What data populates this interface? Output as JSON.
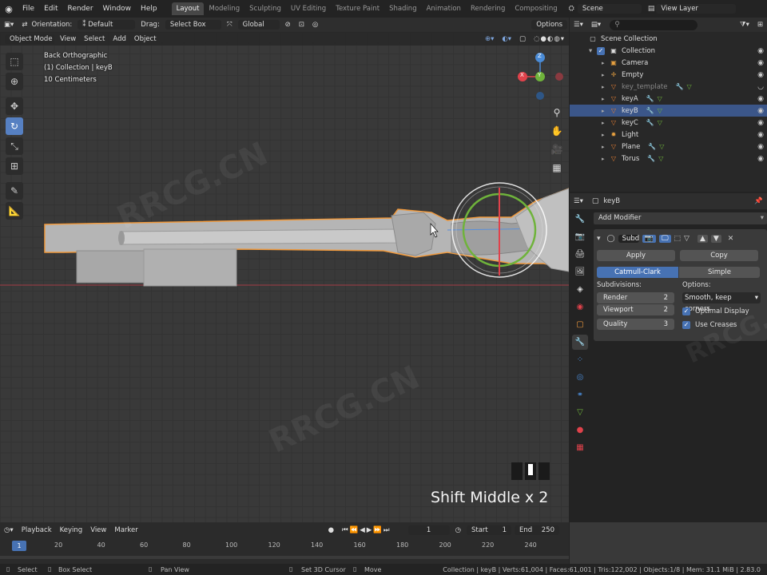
{
  "topbar": {
    "menus": [
      "File",
      "Edit",
      "Render",
      "Window",
      "Help"
    ],
    "workspaces": [
      "Layout",
      "Modeling",
      "Sculpting",
      "UV Editing",
      "Texture Paint",
      "Shading",
      "Animation",
      "Rendering",
      "Compositing"
    ],
    "active_workspace": "Layout",
    "scene": "Scene",
    "view_layer": "View Layer"
  },
  "viewport_header": {
    "orientation_label": "Orientation:",
    "orientation_value": "Default",
    "drag_label": "Drag:",
    "drag_value": "Select Box",
    "transform_value": "Global",
    "options_label": "Options"
  },
  "viewport_menu": {
    "mode": "Object Mode",
    "items": [
      "View",
      "Select",
      "Add",
      "Object"
    ]
  },
  "overlay": {
    "view_name": "Back Orthographic",
    "collection": "(1) Collection | keyB",
    "scale": "10 Centimeters",
    "axis_x": "X",
    "axis_y": "Y",
    "axis_z": "Z"
  },
  "keystroke": "Shift Middle x 2",
  "outliner": {
    "root": "Scene Collection",
    "collection": "Collection",
    "items": [
      {
        "name": "Camera",
        "icon": "camera-icon",
        "color": "#e6a040"
      },
      {
        "name": "Empty",
        "icon": "empty-icon",
        "color": "#e6a040"
      },
      {
        "name": "key_template",
        "icon": "mesh-icon",
        "color": "#e67e33"
      },
      {
        "name": "keyA",
        "icon": "mesh-icon",
        "color": "#e67e33"
      },
      {
        "name": "keyB",
        "icon": "mesh-icon",
        "color": "#e67e33"
      },
      {
        "name": "keyC",
        "icon": "mesh-icon",
        "color": "#e67e33"
      },
      {
        "name": "Light",
        "icon": "light-icon",
        "color": "#e6a040"
      },
      {
        "name": "Plane",
        "icon": "mesh-icon",
        "color": "#e67e33"
      },
      {
        "name": "Torus",
        "icon": "mesh-icon",
        "color": "#e67e33"
      }
    ]
  },
  "properties": {
    "object_name": "keyB",
    "add_modifier": "Add Modifier",
    "modifier_name": "Subd",
    "apply": "Apply",
    "copy": "Copy",
    "catmull": "Catmull-Clark",
    "simple": "Simple",
    "subdivisions_label": "Subdivisions:",
    "options_label": "Options:",
    "render_label": "Render",
    "render_value": "2",
    "viewport_label": "Viewport",
    "viewport_value": "2",
    "quality_label": "Quality",
    "quality_value": "3",
    "uv_smooth": "Smooth, keep corners",
    "optimal_display": "Optimal Display",
    "use_creases": "Use Creases"
  },
  "timeline": {
    "menus": [
      "Playback",
      "Keying",
      "View",
      "Marker"
    ],
    "current_frame": "1",
    "start_label": "Start",
    "start_value": "1",
    "end_label": "End",
    "end_value": "250",
    "ticks": [
      "20",
      "40",
      "60",
      "80",
      "100",
      "120",
      "140",
      "160",
      "180",
      "200",
      "220",
      "240"
    ],
    "playhead": "1"
  },
  "statusbar": {
    "left": [
      "Select",
      "Box Select",
      "Pan View",
      "Set 3D Cursor",
      "Move"
    ],
    "stats": "Collection | keyB | Verts:61,004 | Faces:61,001 | Tris:122,002 | Objects:1/8 | Mem: 31.1 MiB | 2.83.0"
  },
  "watermark": "RRCG.CN",
  "colors": {
    "accent": "#4772b3",
    "selection_orange": "#f09a3e",
    "axis_red": "#e0424b",
    "axis_green": "#6fb33b",
    "axis_blue": "#4a8bd6"
  }
}
